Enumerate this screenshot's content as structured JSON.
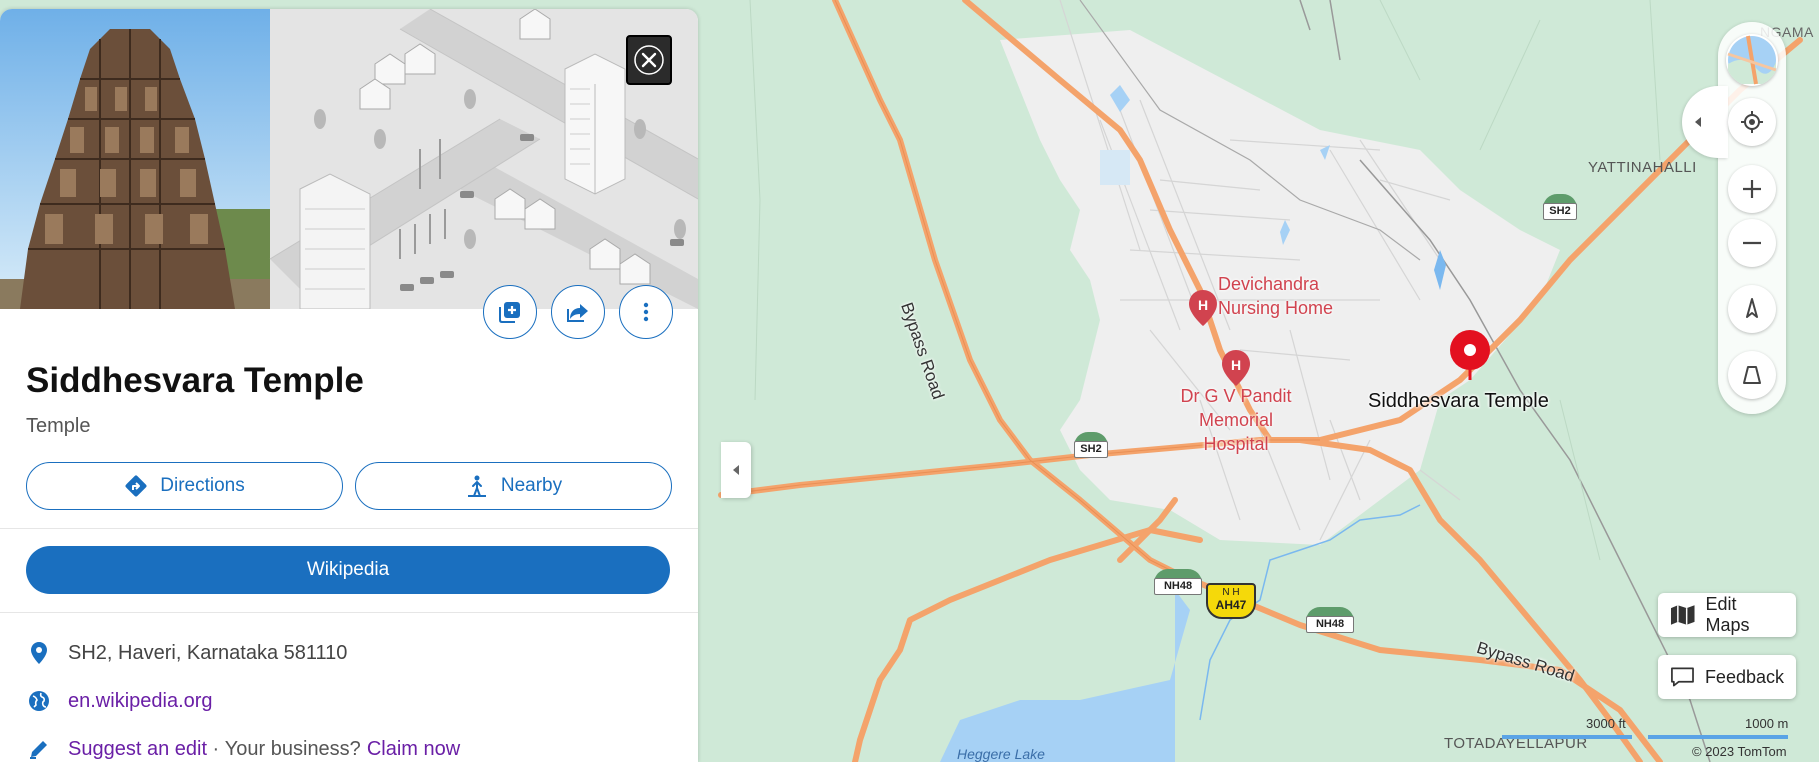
{
  "place": {
    "title": "Siddhesvara Temple",
    "category": "Temple",
    "address": "SH2, Haveri, Karnataka 581110",
    "website": "en.wikipedia.org"
  },
  "actions": {
    "directions": "Directions",
    "nearby": "Nearby",
    "wikipedia": "Wikipedia",
    "suggest_edit": "Suggest an edit",
    "separator": " · ",
    "your_business": "Your business?",
    "claim_now": "Claim now"
  },
  "map": {
    "selected_pin_label": "Siddhesvara Temple",
    "poi_labels": [
      {
        "line1": "Devichandra",
        "line2": "Nursing Home",
        "line3": ""
      },
      {
        "line1": "Dr G V Pandit",
        "line2": "Memorial",
        "line3": "Hospital"
      }
    ],
    "road_labels": {
      "bypass_road_1": "Bypass Road",
      "bypass_road_2": "Bypass Road"
    },
    "area_labels": {
      "yattinahalli": "YATTINAHALLI",
      "totadayellapur": "TOTADAYELLAPUR",
      "heggere_lake": "Heggere Lake",
      "top_right_partial": "NGAMA"
    },
    "shields": {
      "sh2_a": "SH2",
      "sh2_b": "SH2",
      "nh48_a": "NH48",
      "nh48_b": "NH48",
      "nh_ah47_line1": "N H",
      "nh_ah47_line2": "AH47"
    },
    "scale_ft": "3000 ft",
    "scale_m": "1000 m",
    "copyright": "© 2023 TomTom",
    "edit_maps": "Edit Maps",
    "feedback": "Feedback"
  },
  "colors": {
    "accent": "#1a6fbf",
    "link_visited": "#6a1fa6",
    "poi_red": "#d1434f",
    "pin_red": "#e3101f",
    "road_orange": "#f4a36b",
    "map_green": "#cfe9d7",
    "urban_gray": "#eeeeee",
    "water_blue": "#a6d1f5"
  },
  "icons": [
    "close-icon",
    "add-to-collection-icon",
    "share-icon",
    "more-icon",
    "directions-icon",
    "nearby-icon",
    "location-pin-icon",
    "globe-icon",
    "pencil-icon",
    "map-style-icon",
    "locate-icon",
    "zoom-in-icon",
    "zoom-out-icon",
    "compass-icon",
    "tilt-icon",
    "map-icon",
    "feedback-icon",
    "chevron-left-icon"
  ]
}
